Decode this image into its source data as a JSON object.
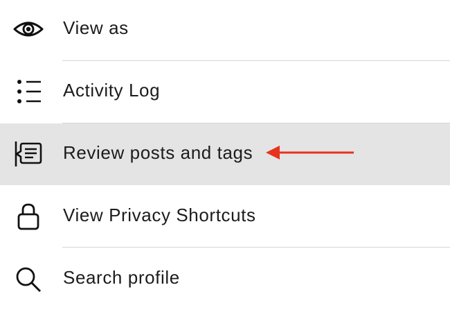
{
  "menu": {
    "items": [
      {
        "label": "View as",
        "icon": "eye-icon"
      },
      {
        "label": "Activity Log",
        "icon": "list-icon"
      },
      {
        "label": "Review posts and tags",
        "icon": "review-posts-icon",
        "highlighted": true
      },
      {
        "label": "View Privacy Shortcuts",
        "icon": "lock-icon"
      },
      {
        "label": "Search profile",
        "icon": "search-icon"
      }
    ]
  },
  "annotation": {
    "arrow_color": "#e8321e",
    "points_to": "Review posts and tags"
  },
  "colors": {
    "highlight_background": "#e4e4e4",
    "text": "#1c1c1c",
    "divider": "#d6d6d6"
  }
}
